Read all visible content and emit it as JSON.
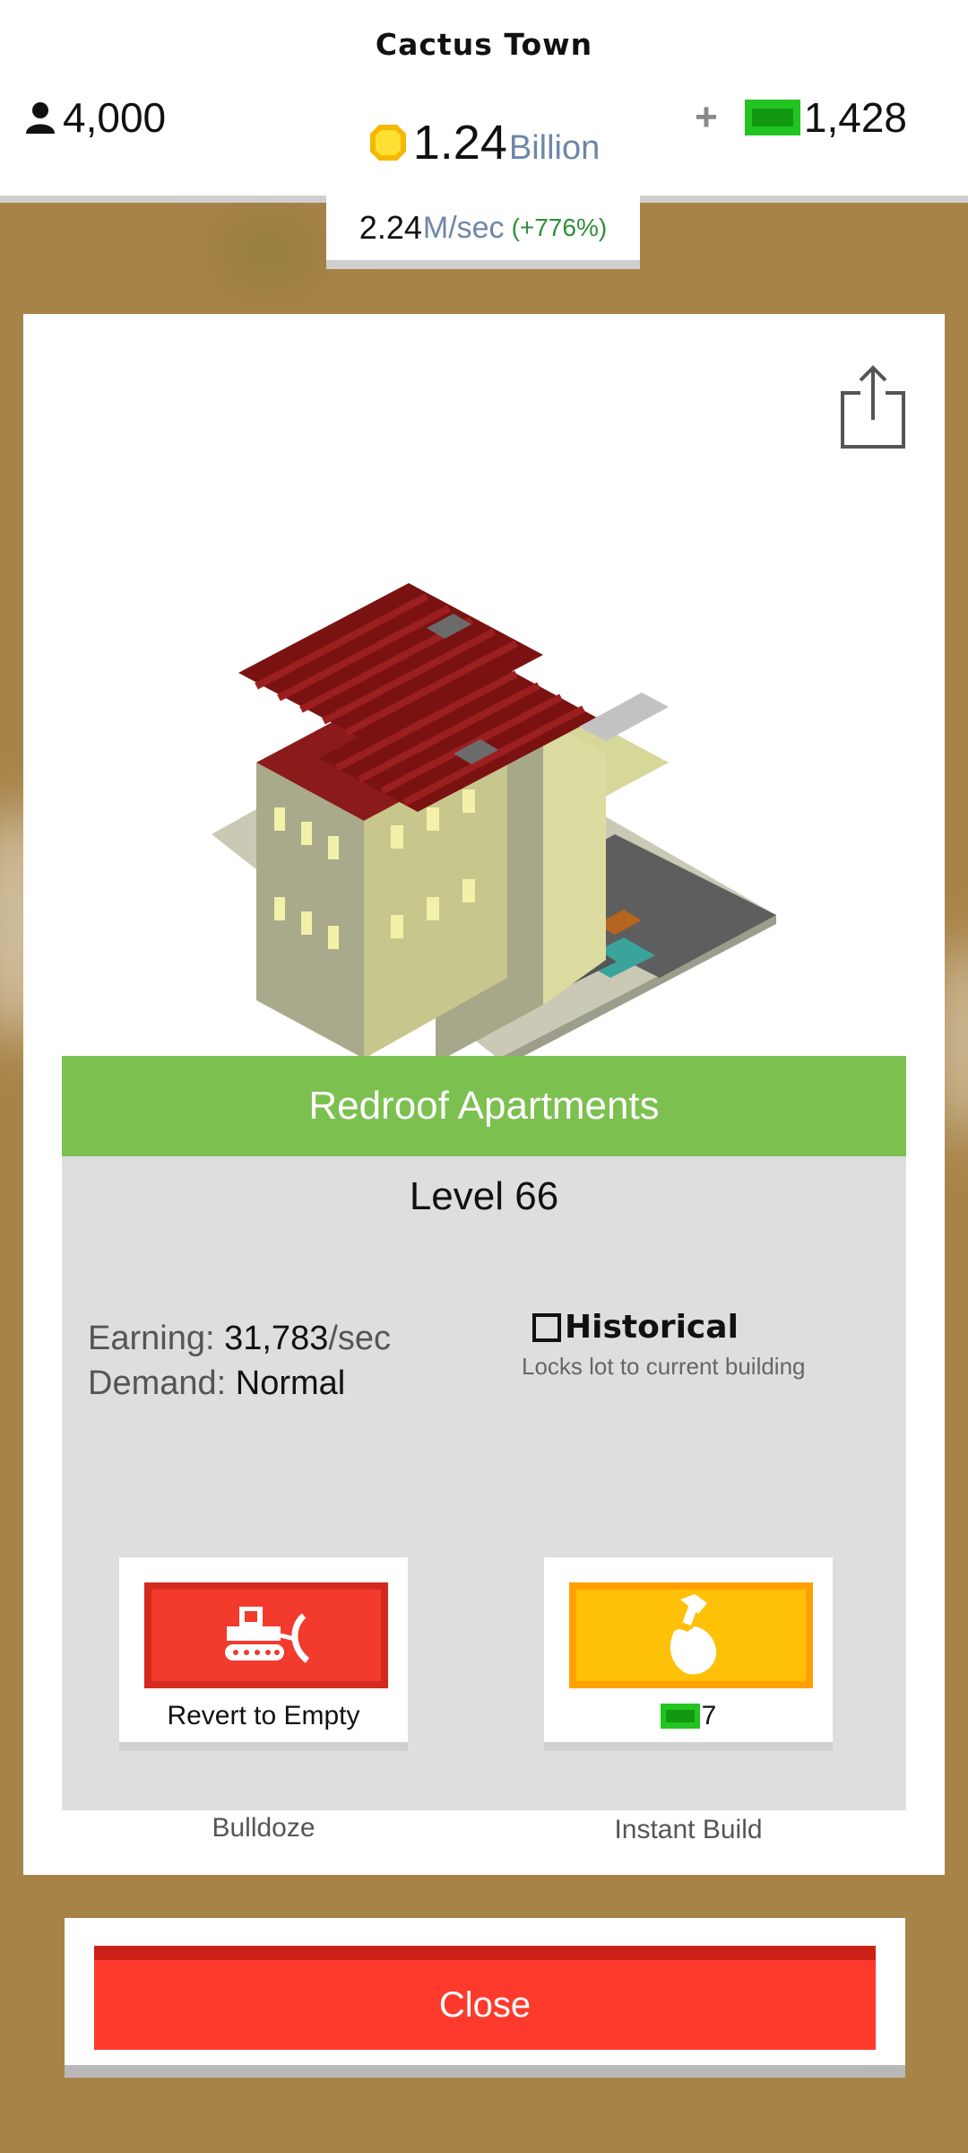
{
  "header": {
    "town_name": "Cactus Town",
    "population": "4,000",
    "coins_amount": "1.24",
    "coins_unit": "Billion",
    "plus_label": "+",
    "cash": "1,428",
    "rate_value": "2.24",
    "rate_unit": "M/sec",
    "rate_bonus": "(+776%)"
  },
  "building": {
    "name": "Redroof Apartments",
    "level": "Level 66",
    "earning_label": "Earning:",
    "earning_value": "31,783",
    "earning_unit": "/sec",
    "demand_label": "Demand:",
    "demand_value": "Normal",
    "historical_label": "Historical",
    "historical_checked": false,
    "historical_desc": "Locks lot to current building"
  },
  "actions": {
    "bulldoze_label": "Bulldoze",
    "bulldoze_caption": "Revert to Empty",
    "instant_label": "Instant Build",
    "instant_cost": "7"
  },
  "footer": {
    "close_label": "Close"
  },
  "icons": {
    "population": "person-icon",
    "coins": "coin-icon",
    "cash": "cash-icon",
    "share": "share-icon",
    "bulldoze": "bulldozer-icon",
    "instant": "hammer-icon"
  },
  "colors": {
    "title_bar": "#7cc04f",
    "bulldoze": "#f23a2d",
    "instant": "#ffc107",
    "close": "#fd3a2c",
    "rate_bonus": "#2f8f3a",
    "unit_text": "#6d87a6"
  }
}
